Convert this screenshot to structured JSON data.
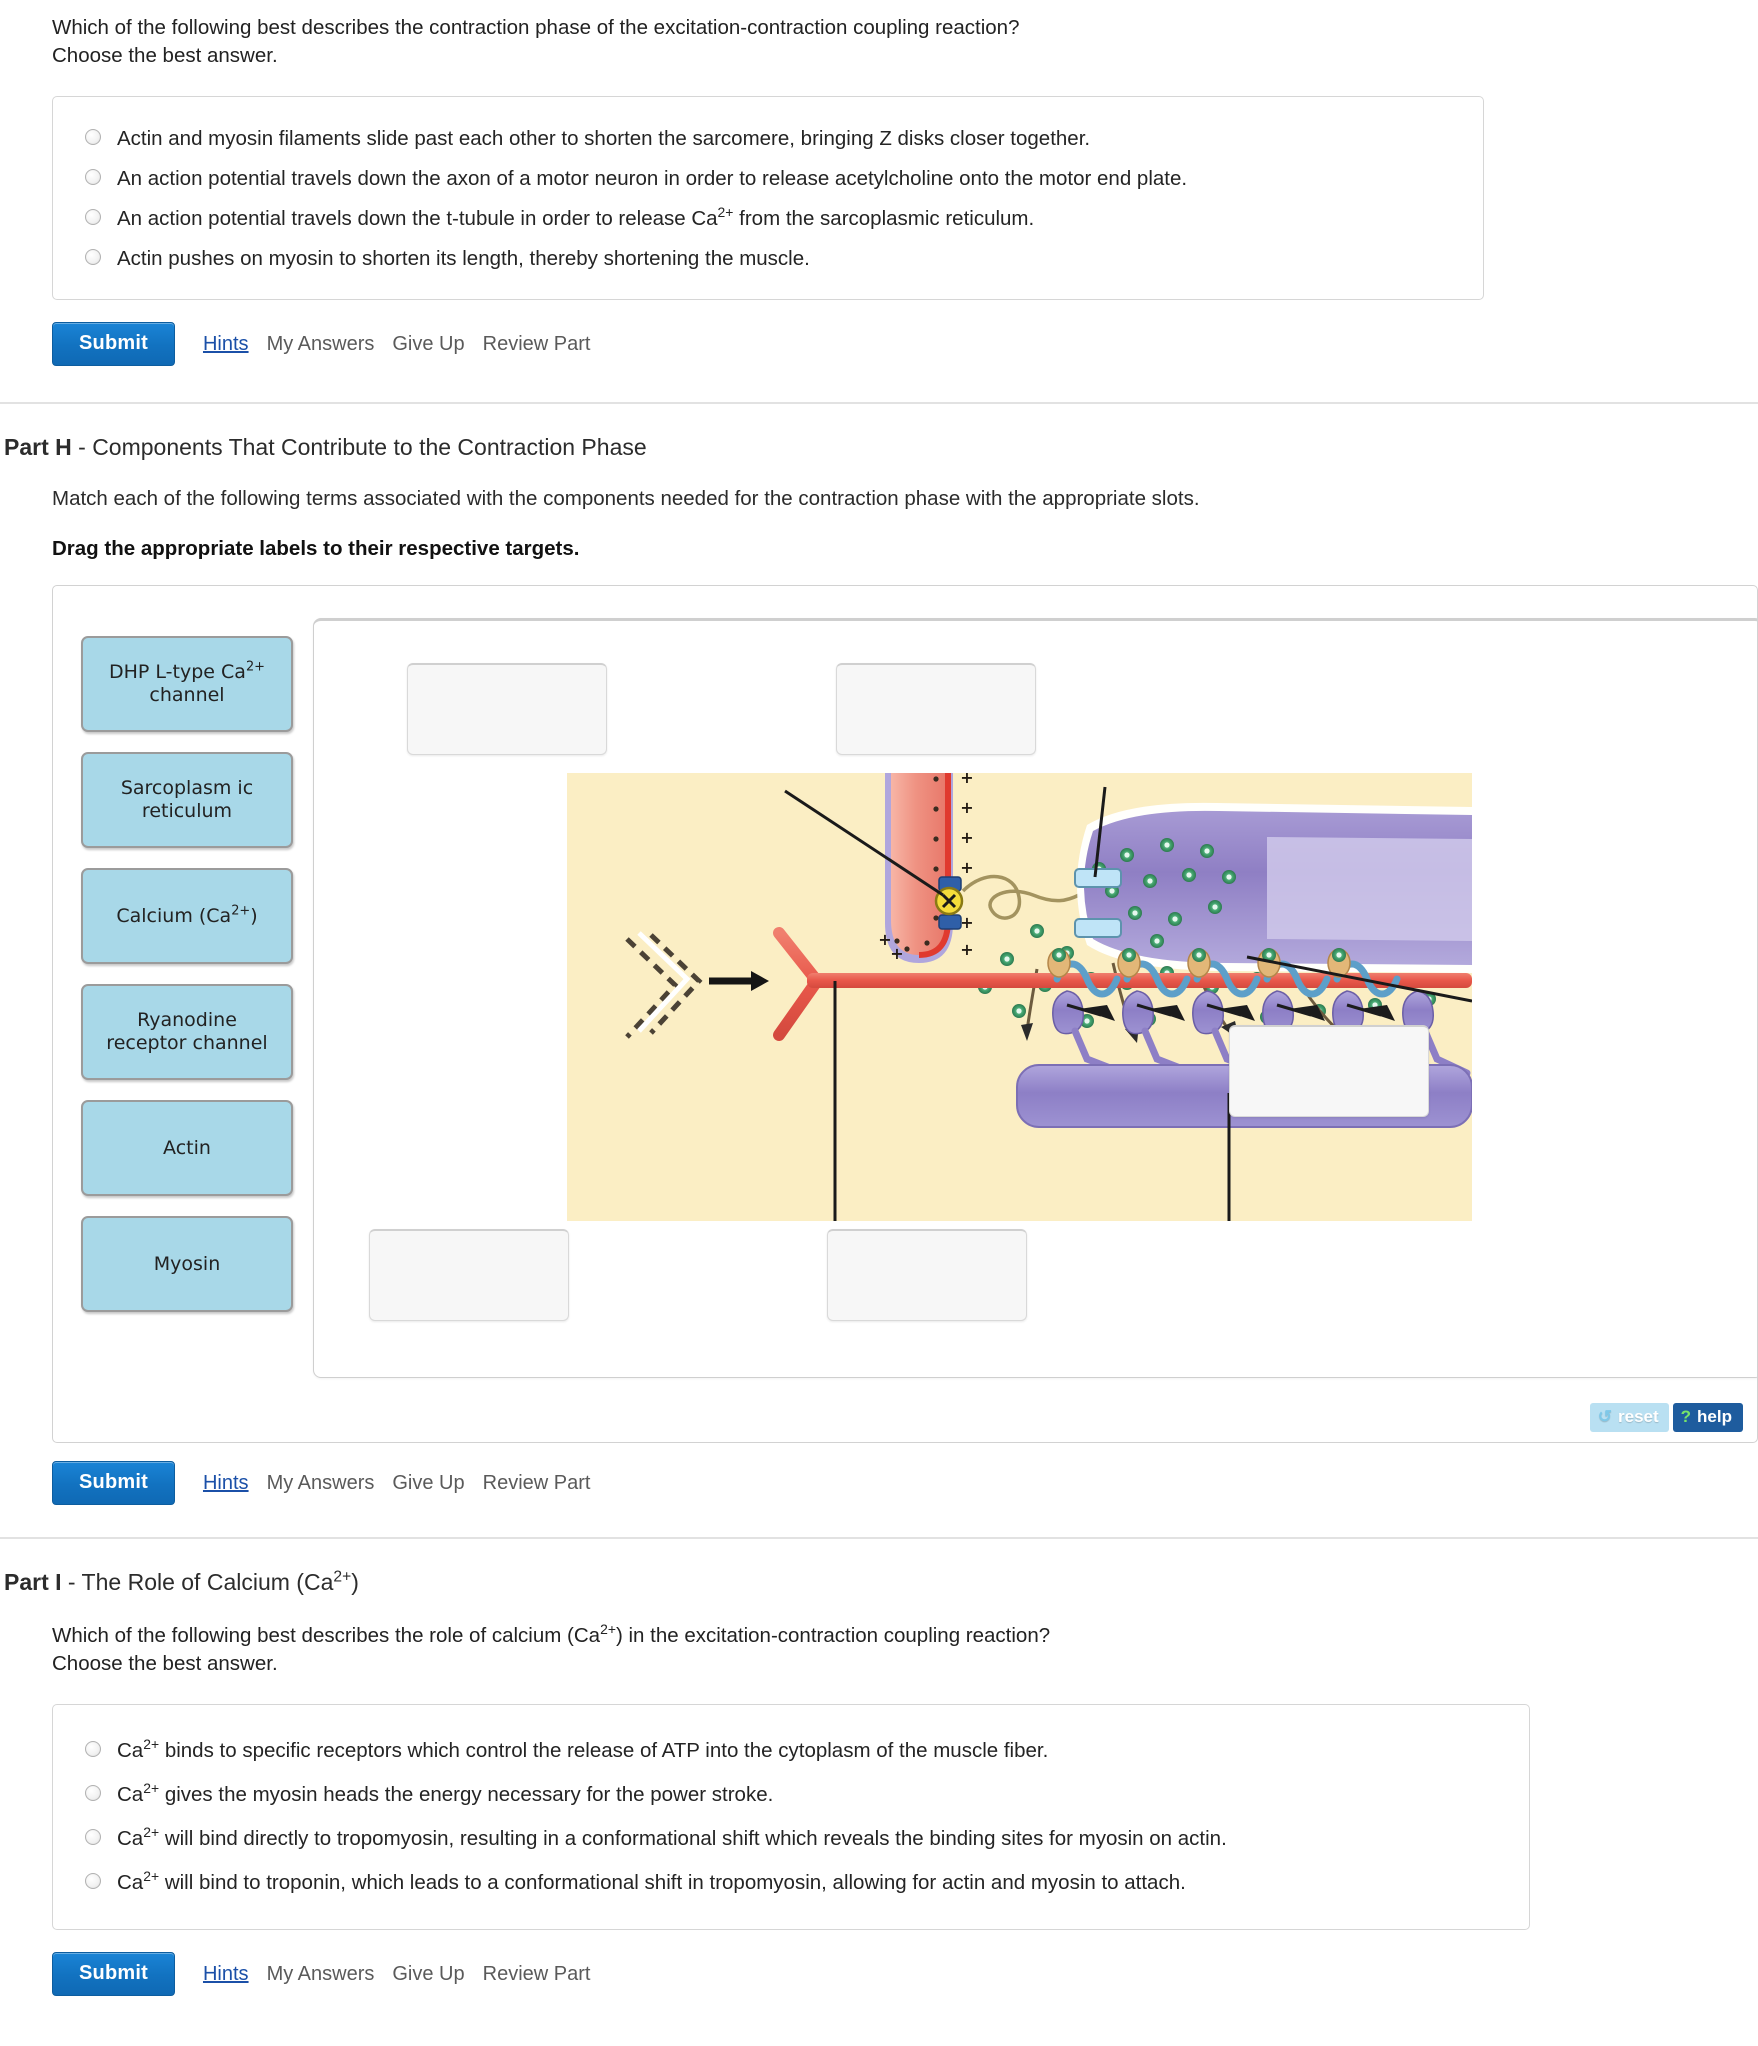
{
  "partG": {
    "prompt_line1": "Which of the following best describes the contraction phase of the excitation-contraction coupling reaction?",
    "prompt_line2": "Choose the best answer.",
    "answers": [
      "Actin and myosin filaments slide past each other to shorten the sarcomere, bringing Z disks closer together.",
      "An action potential travels down the axon of a motor neuron in order to release acetylcholine onto the motor end plate.",
      "An action potential travels down the t-tubule in order to release Ca2+ from the sarcoplasmic reticulum.",
      "Actin pushes on myosin to shorten its length, thereby shortening the muscle."
    ]
  },
  "actionbar": {
    "submit_label": "Submit",
    "hints_label": "Hints",
    "my_answers_label": "My Answers",
    "give_up_label": "Give Up",
    "review_part_label": "Review Part"
  },
  "partH": {
    "title_bold": "Part H",
    "title_rest": " - Components That Contribute to the Contraction Phase",
    "description": "Match each of the following terms associated with the components needed for the contraction phase with the appropriate slots.",
    "instruction": "Drag the appropriate labels to their respective targets.",
    "drag_labels": [
      "DHP L-type Ca2+ channel",
      "Sarcoplasmic reticulum",
      "Calcium (Ca2+)",
      "Ryanodine receptor channel",
      "Actin",
      "Myosin"
    ],
    "drop_targets": [
      "",
      "",
      "",
      "",
      ""
    ],
    "tools": {
      "reset_label": "reset",
      "reset_icon": "refresh-icon",
      "help_label": "help",
      "help_icon": "question-mark-icon"
    }
  },
  "partI": {
    "title_bold": "Part I",
    "title_rest": " - The Role of Calcium (Ca2+)",
    "prompt_line1": "Which of the following best describes the role of calcium (Ca2+) in the excitation-contraction coupling reaction?",
    "prompt_line2": "Choose the best answer.",
    "answers": [
      "Ca2+ binds to specific receptors which control the release of ATP into the cytoplasm of the muscle fiber.",
      "Ca2+ gives the myosin heads the energy necessary for the power stroke.",
      "Ca2+ will bind directly to tropomyosin, resulting in a conformational shift which reveals the binding sites for myosin on actin.",
      "Ca2+ will bind to troponin, which leads to a conformational shift in tropomyosin, allowing for actin and myosin to attach."
    ]
  },
  "colors": {
    "accent_blue": "#1272c0",
    "link_blue": "#1b50a8",
    "label_fill": "#a8d8e8",
    "cytoplasm": "#fbeec4",
    "t_tubule": "#ef8d7d",
    "sr_purple": "#8c7fc0",
    "actin_red": "#e8574a",
    "calcium_green": "#3f9e6a"
  }
}
